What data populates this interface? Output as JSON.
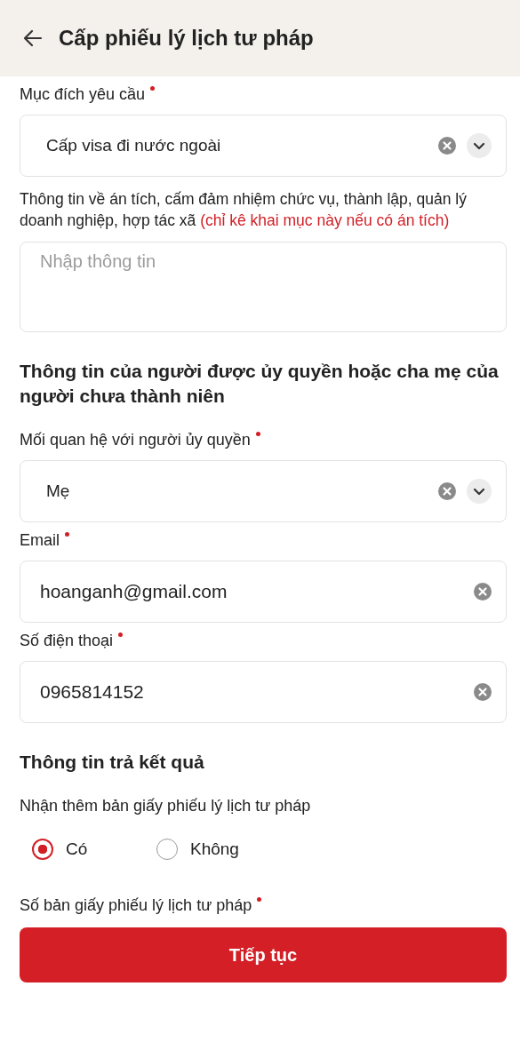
{
  "header": {
    "title": "Cấp phiếu lý lịch tư pháp"
  },
  "form": [
    {
      "kind": "select",
      "label": "Mục đích yêu cầu",
      "required": true,
      "value": "Cấp visa đi nước ngoài"
    },
    {
      "kind": "textarea",
      "label": "Thông tin về án tích, cấm đảm nhiệm chức vụ, thành lập, quản lý doanh nghiệp, hợp tác xã",
      "note": "(chỉ kê khai mục này nếu có án tích)",
      "placeholder": "Nhập thông tin"
    },
    {
      "kind": "heading",
      "text": "Thông tin của người được ủy quyền hoặc cha mẹ của người chưa thành niên"
    },
    {
      "kind": "select",
      "label": "Mối quan hệ với người ủy quyền",
      "required": true,
      "value": "Mẹ"
    },
    {
      "kind": "input",
      "label": "Email",
      "required": true,
      "value": "hoanganh@gmail.com"
    },
    {
      "kind": "input",
      "label": "Số điện thoại",
      "required": true,
      "value": "0965814152"
    },
    {
      "kind": "heading",
      "text": "Thông tin trả kết quả"
    },
    {
      "kind": "radio",
      "label": "Nhận thêm bản giấy phiếu lý lịch tư pháp",
      "options": [
        {
          "label": "Có",
          "selected": true
        },
        {
          "label": "Không",
          "selected": false
        }
      ]
    },
    {
      "kind": "label",
      "label": "Số bản giấy phiếu lý lịch tư pháp",
      "required": true
    }
  ],
  "button": "Tiếp tục"
}
